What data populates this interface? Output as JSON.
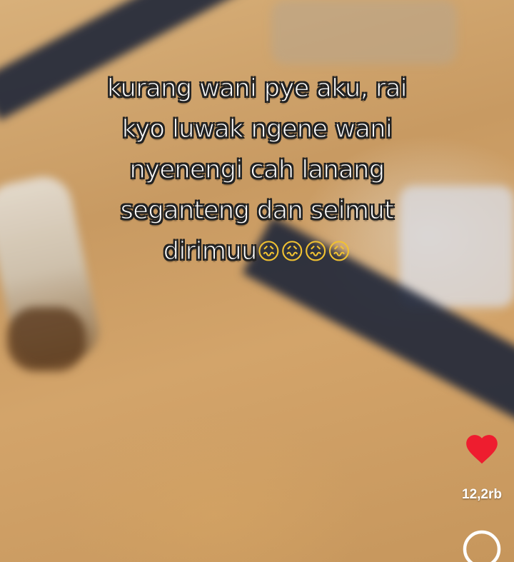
{
  "caption": {
    "lines": [
      "kurang wani pye aku, rai",
      "kyo luwak ngene wani",
      "nyenengi cah lanang",
      "seganteng dan seimut",
      "dirimuu"
    ],
    "emoji": "😖😖😖😖"
  },
  "actions": {
    "like_count": "12,2rb",
    "like_icon": "heart-icon",
    "comment_icon": "comment-icon",
    "like_color": "#ee1d2f"
  }
}
